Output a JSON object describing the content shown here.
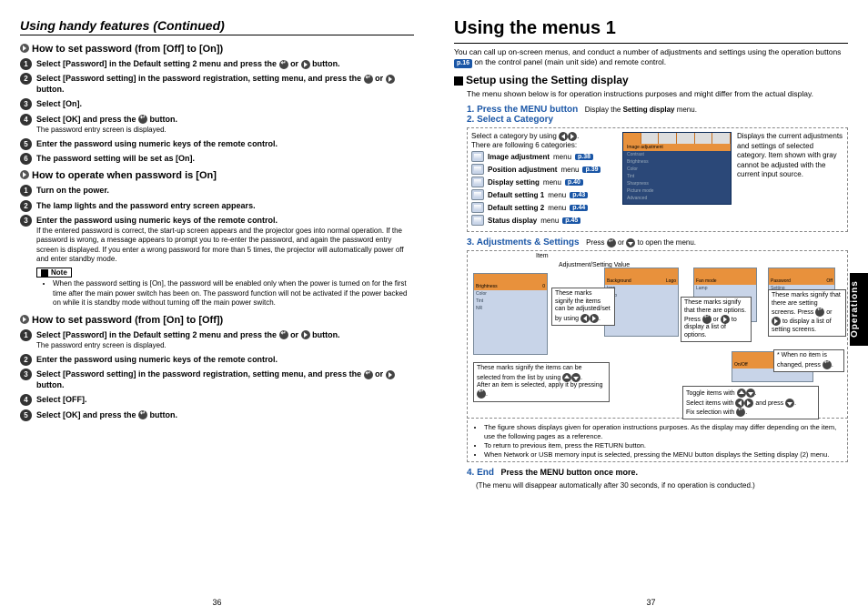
{
  "left": {
    "section_title": "Using handy features (Continued)",
    "h1": "How to set password (from [Off] to [On])",
    "s1_1a": "Select [Password] in the Default setting 2 menu and press the ",
    "s1_1b": " or ",
    "s1_1c": " button.",
    "s1_2a": "Select [Password setting] in the password registration, setting menu, and press the ",
    "s1_2b": " or ",
    "s1_2c": " button.",
    "s1_3": "Select [On].",
    "s1_4a": "Select [OK] and press the ",
    "s1_4b": " button.",
    "s1_4d": "The password entry screen is displayed.",
    "s1_5": "Enter the password using numeric keys of the remote control.",
    "s1_6": "The password setting will be set as [On].",
    "h2": "How to operate when password is [On]",
    "s2_1": "Turn on the power.",
    "s2_2": "The lamp lights and the password entry screen appears.",
    "s2_3": "Enter the password using numeric keys of the remote control.",
    "s2_3d": "If the entered password is correct, the start-up screen appears and the projector goes into normal operation. If the password is wrong, a message appears to prompt you to re-enter the password, and again the password entry screen is displayed. If you enter a wrong password for more than 5 times, the projector will automatically power off and enter standby mode.",
    "note_label": "Note",
    "note_body": "When the password setting is [On], the password will be enabled only when the power is turned on for the first time after the main power switch has been on. The password function will not be activated if the power backed on while it is standby mode without turning off the main power switch.",
    "h3": "How to set password (from [On] to [Off])",
    "s3_1a": "Select [Password] in the Default setting 2 menu and press the ",
    "s3_1b": " or ",
    "s3_1c": " button.",
    "s3_1d": "The password entry screen is displayed.",
    "s3_2": "Enter the password using numeric keys of the remote control.",
    "s3_3a": "Select [Password setting] in the password registration, setting menu, and press the ",
    "s3_3b": " or ",
    "s3_3c": " button.",
    "s3_4": "Select [OFF].",
    "s3_5a": "Select [OK] and press the ",
    "s3_5b": " button.",
    "page_num": "36"
  },
  "right": {
    "title": "Using the menus 1",
    "intro1": "You can call up on-screen menus, and conduct a number of adjustments and settings using the operation buttons ",
    "intro_ref": "p.16",
    "intro2": " on the control panel (main unit side) and remote control.",
    "setup_head": "Setup using the Setting display",
    "setup_body": "The menu shown below is for operation instructions purposes and might differ from the actual display.",
    "step1": "1. Press the MENU button",
    "step1_desc_a": "Display the ",
    "step1_desc_b": "Setting display",
    "step1_desc_c": " menu.",
    "step2": "2. Select a Category",
    "cat_intro1": "Select a category by using ",
    "cat_intro2": "There are following 6 categories:",
    "cats": [
      {
        "label": "Image adjustment",
        "suffix": " menu",
        "ref": "p.38"
      },
      {
        "label": "Position adjustment",
        "suffix": " menu",
        "ref": "p.39"
      },
      {
        "label": "Display setting",
        "suffix": " menu",
        "ref": "p.40"
      },
      {
        "label": "Default setting 1",
        "suffix": " menu",
        "ref": "p.43"
      },
      {
        "label": "Default setting 2",
        "suffix": " menu",
        "ref": "p.44"
      },
      {
        "label": "Status display",
        "suffix": " menu",
        "ref": "p.45"
      }
    ],
    "cat_desc": "Displays the current adjustments and settings of selected category. Item shown with gray cannot be adjusted with the current input source.",
    "osd_title": "Image adjustment",
    "osd_rows": [
      "Contrast",
      "Brightness",
      "Color",
      "Tint",
      "Sharpness",
      "Picture mode",
      "Advanced"
    ],
    "step3": "3. Adjustments & Settings",
    "step3_desc_a": "Press ",
    "step3_desc_b": " or ",
    "step3_desc_c": " to open the menu.",
    "label_item": "Item",
    "label_adj": "Adjustment/Setting Value",
    "co_adj": "These marks signify the items can be adjusted/set by using ",
    "co_sel_a": "These marks signify the items can be selected from the list by using ",
    "co_sel_b": "After an item is selected, apply it by pressing ",
    "co_opt_a": "These marks signify that there are options. Press ",
    "co_opt_b": " or ",
    "co_opt_c": " to display a list of options.",
    "co_scr_a": "These marks signify that there are setting screens. Press ",
    "co_scr_b": " or ",
    "co_scr_c": " to display a list of setting screens.",
    "co_none_a": "* When no item is changed, press ",
    "co_tog_a": "Toggle items with ",
    "co_tog_b": "Select items with ",
    "co_tog_c": " and press ",
    "co_tog_d": "Fix selection with ",
    "fig_b1": "The figure shows displays given for operation instructions purposes. As the display may differ depending on the item, use the following pages as a reference.",
    "fig_b2": "To return to previous item, press the RETURN button.",
    "fig_b3": "When Network or USB memory input is selected, pressing the MENU button displays the Setting display (2) menu.",
    "step4": "4. End",
    "step4_head": "Press the MENU button once more.",
    "step4_desc": "(The menu will disappear automatically after 30 seconds, if no operation is conducted.)",
    "side_tab": "Operations",
    "page_num": "37"
  }
}
